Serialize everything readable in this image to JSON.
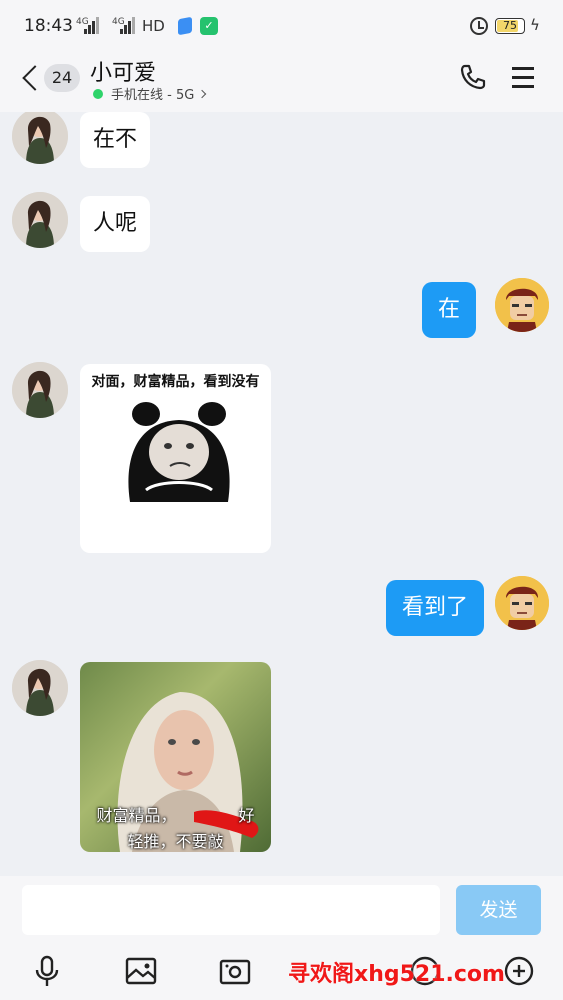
{
  "status_bar": {
    "time": "18:43",
    "network_1": "4G",
    "network_2": "4G",
    "hd_label": "HD",
    "battery_level": "75",
    "battery_fraction": 0.75,
    "icons": [
      "signal-icon",
      "alarm-icon",
      "battery-icon",
      "charging-icon"
    ]
  },
  "header": {
    "unread_count": "24",
    "contact_name": "小可爱",
    "online_status": "手机在线 - 5G",
    "online_color": "#2ed36a",
    "icons": [
      "back-icon",
      "phone-icon",
      "menu-icon"
    ]
  },
  "messages": [
    {
      "side": "left",
      "type": "text",
      "text": "在不"
    },
    {
      "side": "left",
      "type": "text",
      "text": "人呢"
    },
    {
      "side": "right",
      "type": "text",
      "text": "在"
    },
    {
      "side": "left",
      "type": "sticker",
      "text": "对面，财富精品，看到没有"
    },
    {
      "side": "right",
      "type": "text",
      "text": "看到了"
    },
    {
      "side": "left",
      "type": "image",
      "caption_line1": "财富精品，",
      "caption_line1_end": "好",
      "caption_line2": "轻推，不要敲"
    }
  ],
  "composer": {
    "input_value": "",
    "send_label": "发送",
    "send_color": "#89c9f5",
    "accent_color": "#1d9bf5",
    "toolbar": [
      "microphone-icon",
      "image-icon",
      "camera-icon",
      "emoji-icon",
      "more-icon"
    ]
  },
  "watermark": "寻欢阁xhg521.com"
}
